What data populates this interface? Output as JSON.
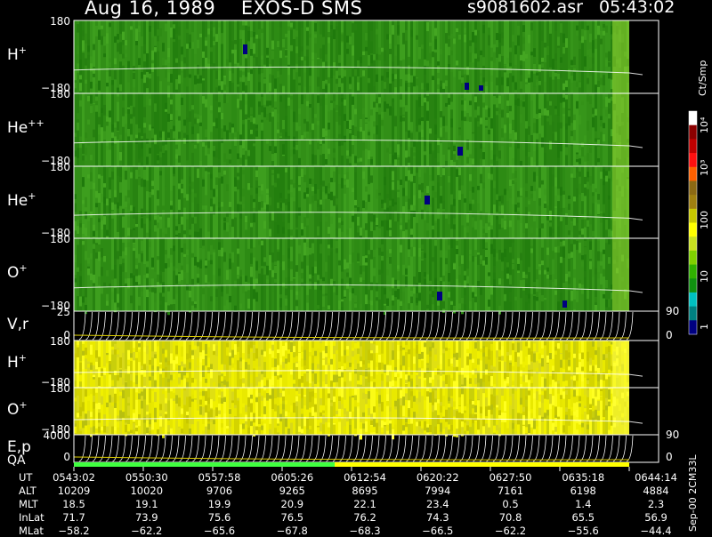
{
  "header": {
    "title": "Aug 16, 1989    EXOS-D SMS",
    "file": "s9081602.asr   05:43:02"
  },
  "panels": [
    {
      "id": "h-plus",
      "label": "H",
      "sup": "+",
      "ytop": "180",
      "ybot": "−180",
      "base": "green",
      "ybound": [
        23,
        105
      ]
    },
    {
      "id": "he-plusplus",
      "label": "He",
      "sup": "++",
      "ytop": "180",
      "ybot": "−180",
      "base": "green",
      "ybound": [
        105,
        187
      ]
    },
    {
      "id": "he-plus",
      "label": "He",
      "sup": "+",
      "ytop": "180",
      "ybot": "−180",
      "base": "green",
      "ybound": [
        187,
        268
      ]
    },
    {
      "id": "o-plus",
      "label": "O",
      "sup": "+",
      "ytop": "180",
      "ybot": "−180",
      "base": "green",
      "ybound": [
        268,
        350
      ]
    },
    {
      "id": "vr",
      "label": "V,r",
      "sup": "",
      "ytop": "25",
      "ybot": "0",
      "rtop": "90",
      "rbot": "0",
      "base": "black",
      "ybound": [
        350,
        383
      ]
    },
    {
      "id": "h-plus-2",
      "label": "H",
      "sup": "+",
      "ytop": "180",
      "ybot": "−180",
      "base": "yellow",
      "ybound": [
        383,
        436
      ]
    },
    {
      "id": "o-plus-2",
      "label": "O",
      "sup": "+",
      "ytop": "180",
      "ybot": "−180",
      "base": "yellow",
      "ybound": [
        436,
        489
      ]
    },
    {
      "id": "ep",
      "label": "E,p",
      "sup": "",
      "ytop": "4000",
      "ybot": "0",
      "rtop": "90",
      "rbot": "0",
      "base": "black",
      "ybound": [
        489,
        520
      ]
    }
  ],
  "qa_label": "QA",
  "colorbar": {
    "unit": "Ct/Smp",
    "ticks": [
      "10⁴",
      "10³",
      "100",
      "10",
      "1"
    ],
    "colors": [
      "#ffffff",
      "#8b0000",
      "#c00000",
      "#ff1010",
      "#ff6000",
      "#8b6914",
      "#a08010",
      "#c8c800",
      "#ffff00",
      "#c8e020",
      "#80d000",
      "#30b000",
      "#109010",
      "#00c0c0",
      "#008080",
      "#000080"
    ]
  },
  "footer": {
    "rows": [
      {
        "label": "UT",
        "values": [
          "0543:02",
          "0550:30",
          "0557:58",
          "0605:26",
          "0612:54",
          "0620:22",
          "0627:50",
          "0635:18",
          "0644:14"
        ]
      },
      {
        "label": "ALT",
        "values": [
          "10209",
          "10020",
          "9706",
          "9265",
          "8695",
          "7994",
          "7161",
          "6198",
          "4884"
        ]
      },
      {
        "label": "MLT",
        "values": [
          "18.5",
          "19.1",
          "19.9",
          "20.9",
          "22.1",
          "23.4",
          "0.5",
          "1.4",
          "2.3"
        ]
      },
      {
        "label": "InLat",
        "values": [
          "71.7",
          "73.9",
          "75.6",
          "76.5",
          "76.2",
          "74.3",
          "70.8",
          "65.5",
          "56.9"
        ]
      },
      {
        "label": "MLat",
        "values": [
          "−58.2",
          "−62.2",
          "−65.6",
          "−67.8",
          "−68.3",
          "−66.5",
          "−62.2",
          "−55.6",
          "−44.4"
        ]
      }
    ],
    "id": "Sep-00 2CM33L"
  },
  "chart_data": {
    "type": "heatmap",
    "title": "Aug 16, 1989    EXOS-D SMS",
    "x_ticks": [
      "0543:02",
      "0550:30",
      "0557:58",
      "0605:26",
      "0612:54",
      "0620:22",
      "0627:50",
      "0635:18",
      "0644:14"
    ],
    "colorbar_unit": "Ct/Smp",
    "colorbar_ticks": [
      "1",
      "10",
      "100",
      "10³",
      "10⁴"
    ],
    "panels": [
      "H+",
      "He++",
      "He+",
      "O+",
      "V,r",
      "H+",
      "O+",
      "E,p"
    ]
  }
}
